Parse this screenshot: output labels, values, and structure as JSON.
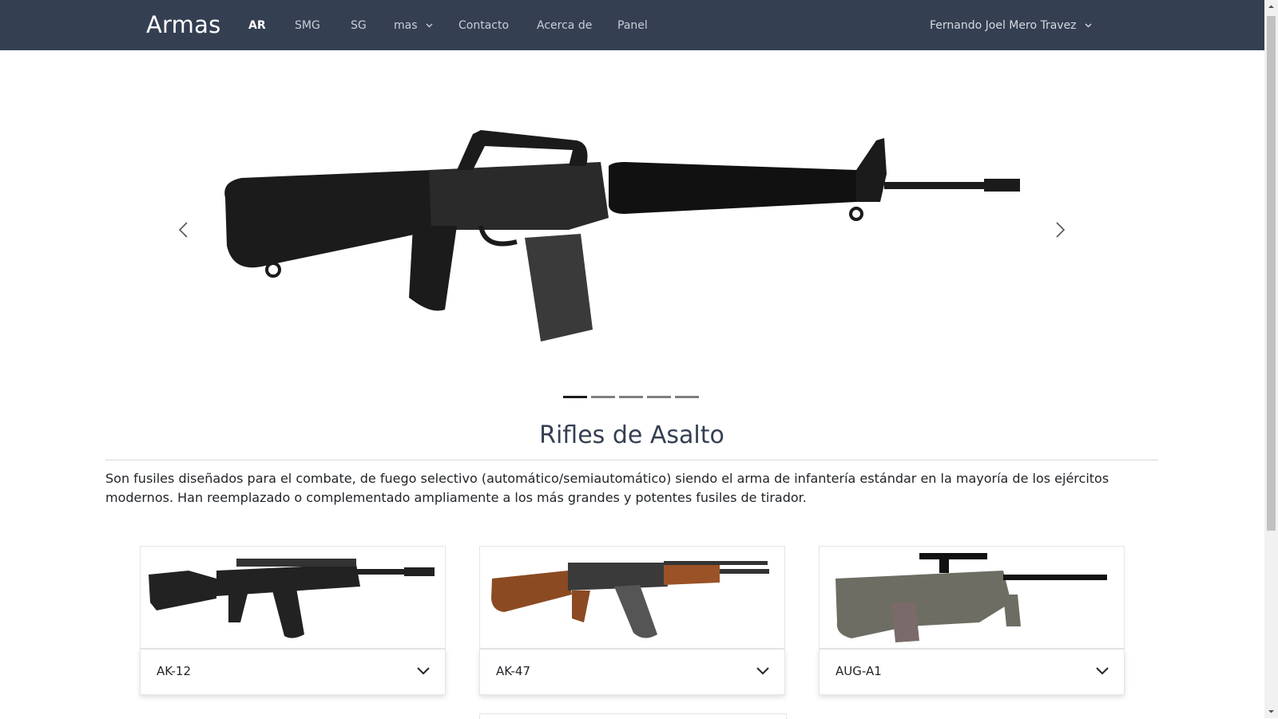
{
  "navbar": {
    "brand": "Armas",
    "links": [
      {
        "label": "AR",
        "active": true
      },
      {
        "label": "SMG"
      },
      {
        "label": "SG"
      },
      {
        "label": "mas",
        "dropdown": true
      },
      {
        "label": "Contacto"
      },
      {
        "label": "Acerca de"
      },
      {
        "label": "Panel"
      }
    ],
    "user": "Fernando Joel Mero Travez",
    "bg_color": "#343f52"
  },
  "carousel": {
    "slide_count": 5,
    "active_index": 0,
    "current_image": "m16-rifle"
  },
  "section": {
    "title": "Rifles de Asalto",
    "description": "Son fusiles diseñados para el combate, de fuego selectivo (automático/semiautomático) siendo el arma de infantería estándar en la mayoría de los ejércitos modernos. Han reemplazado o complementado ampliamente a los más grandes y potentes fusiles de tirador."
  },
  "cards": [
    {
      "title": "AK-12",
      "image": "ak12-rifle"
    },
    {
      "title": "AK-47",
      "image": "ak47-rifle"
    },
    {
      "title": "AUG-A1",
      "image": "aug-a1-rifle"
    }
  ]
}
